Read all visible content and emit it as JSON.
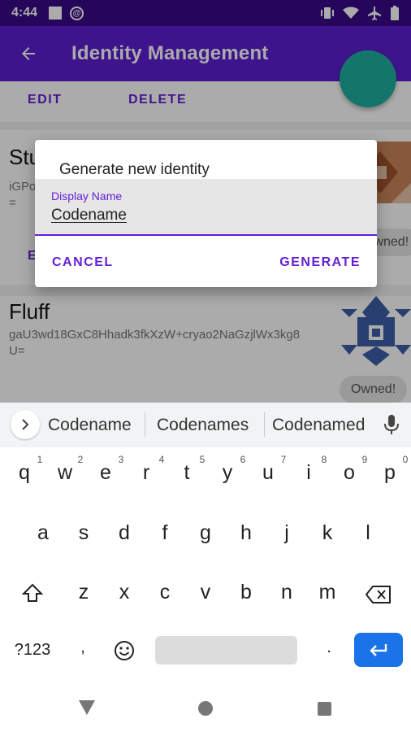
{
  "status_bar": {
    "time": "4:44",
    "icons": [
      "square-notification-icon",
      "at-sign-icon",
      "vibrate-icon",
      "wifi-icon",
      "airplane-icon",
      "battery-icon"
    ]
  },
  "app_bar": {
    "title": "Identity Management",
    "back_icon": "arrow-left-icon"
  },
  "toolbar": {
    "edit_label": "EDIT",
    "delete_label": "DELETE"
  },
  "identities": [
    {
      "name": "Stu",
      "key_line1": "iGPo",
      "key_line2": "=",
      "owned_label": "Owned!",
      "edit_label": "E"
    },
    {
      "name": "Fluff",
      "key_line1": "gaU3wd18GxC8Hhadk3fkXzW+cryao2NaGzjlWx3kg8",
      "key_line2": "U=",
      "owned_label": "Owned!"
    }
  ],
  "dialog": {
    "title": "Generate new identity",
    "field_label": "Display Name",
    "field_value": "Codename",
    "cancel_label": "CANCEL",
    "generate_label": "GENERATE"
  },
  "keyboard": {
    "suggestions": [
      "Codename",
      "Codenames",
      "Codenamed"
    ],
    "row1": [
      "q",
      "w",
      "e",
      "r",
      "t",
      "y",
      "u",
      "i",
      "o",
      "p"
    ],
    "row1_hints": [
      "1",
      "2",
      "3",
      "4",
      "5",
      "6",
      "7",
      "8",
      "9",
      "0"
    ],
    "row2": [
      "a",
      "s",
      "d",
      "f",
      "g",
      "h",
      "j",
      "k",
      "l"
    ],
    "row3": [
      "z",
      "x",
      "c",
      "v",
      "b",
      "n",
      "m"
    ],
    "symbols_label": "?123",
    "comma_label": ",",
    "period_label": ".",
    "emoji_icon": "emoji-icon",
    "enter_icon": "enter-arrow-icon"
  },
  "colors": {
    "primary": "#5b1fd0",
    "status_bar": "#3a0a88",
    "accent": "#6420d6",
    "fab": "#1eb19f",
    "enter_key": "#1a73e8"
  }
}
